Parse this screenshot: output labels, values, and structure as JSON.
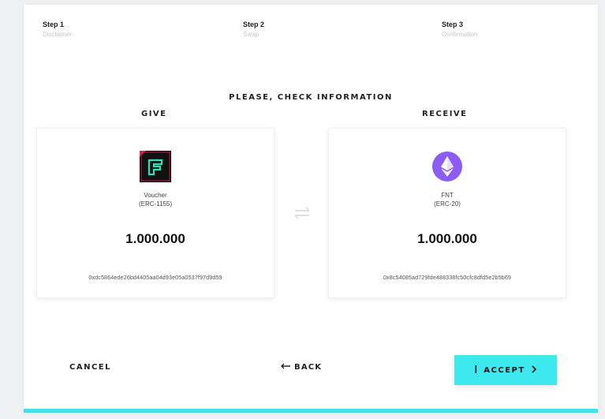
{
  "steps": [
    {
      "title": "Step 1",
      "subtitle": "Disclaimer"
    },
    {
      "title": "Step 2",
      "subtitle": "Swap"
    },
    {
      "title": "Step 3",
      "subtitle": "Confirmation"
    }
  ],
  "heading": "PLEASE, CHECK INFORMATION",
  "give": {
    "label": "GIVE",
    "token_name": "Voucher",
    "token_standard": "(ERC-1155)",
    "amount": "1.000.000",
    "address": "0xdc5864ede26bd4405aa04d93e05a0537f97d9d59",
    "icon": "voucher-token-icon"
  },
  "receive": {
    "label": "RECEIVE",
    "token_name": "FNT",
    "token_standard": "(ERC-20)",
    "amount": "1.000.000",
    "address": "0x8c54085ad729fde488338fc50cfc8dfd5e2b5b69",
    "icon": "ethereum-icon"
  },
  "actions": {
    "cancel": "CANCEL",
    "back": "BACK",
    "accept": "ACCEPT"
  },
  "colors": {
    "accent": "#3de8ee",
    "ethereum": "#8b5cf6",
    "voucher_bg": "#111111",
    "voucher_glyph": "#2fe0b4"
  }
}
